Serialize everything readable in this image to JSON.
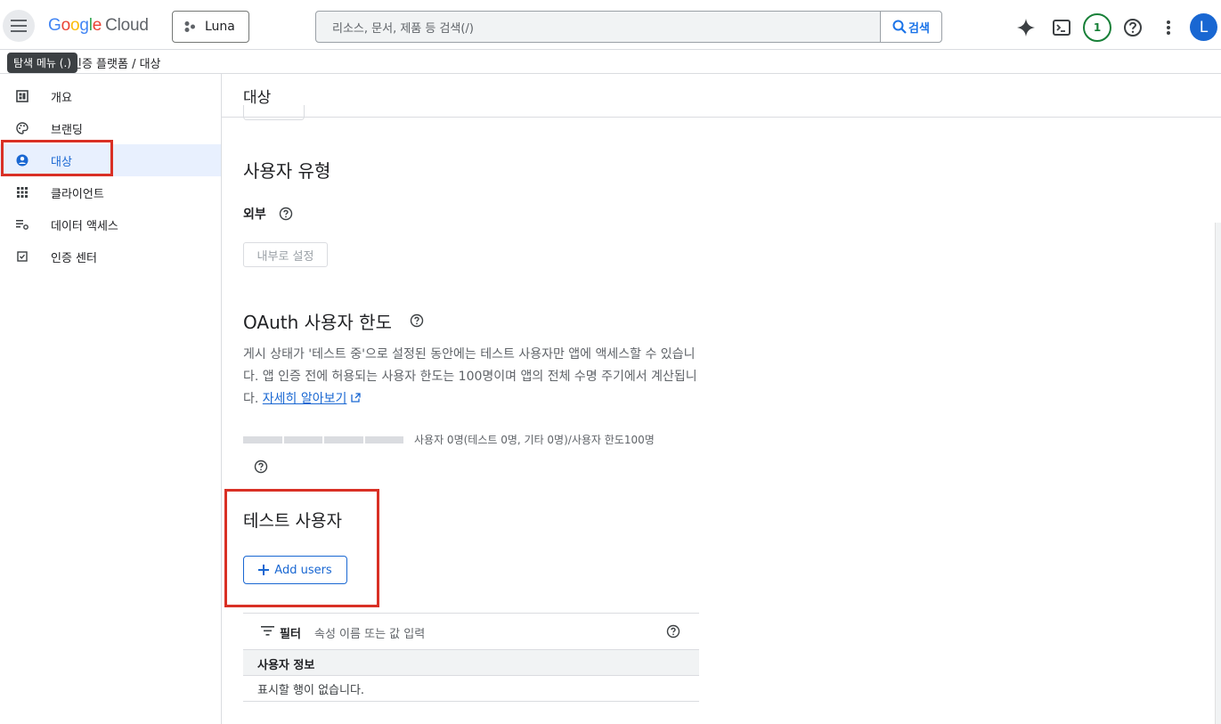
{
  "header": {
    "menu_tooltip": "탐색 메뉴 (.)",
    "logo_google": [
      "G",
      "o",
      "o",
      "g",
      "l",
      "e"
    ],
    "logo_cloud": "Cloud",
    "project_name": "Luna",
    "search_placeholder": "리소스, 문서, 제품 등 검색(/)",
    "search_button": "검색",
    "notifications_count": "1",
    "avatar_letter": "L"
  },
  "breadcrumb": {
    "text": "Google 인증 플랫폼 / 대상",
    "visible": "인증 플랫폼  /  대상"
  },
  "sidebar": {
    "items": [
      {
        "label": "개요",
        "icon": "dashboard-icon"
      },
      {
        "label": "브랜딩",
        "icon": "palette-icon"
      },
      {
        "label": "대상",
        "icon": "account-circle-icon",
        "active": true
      },
      {
        "label": "클라이언트",
        "icon": "apps-grid-icon"
      },
      {
        "label": "데이터 액세스",
        "icon": "data-settings-icon"
      },
      {
        "label": "인증 센터",
        "icon": "verified-check-icon"
      }
    ]
  },
  "main": {
    "page_title": "대상",
    "user_type": {
      "heading": "사용자 유형",
      "value": "외부",
      "button": "내부로 설정"
    },
    "oauth_limit": {
      "heading": "OAuth 사용자 한도",
      "paragraph": "게시 상태가 '테스트 중'으로 설정된 동안에는 테스트 사용자만 앱에 액세스할 수 있습니다. 앱 인증 전에 허용되는 사용자 한도는 100명이며 앱의 전체 수명 주기에서 계산됩니다.",
      "learn_more": "자세히 알아보기",
      "usage_text": "사용자 0명(테스트 0명, 기타 0명)/사용자 한도100명",
      "usage_fraction": 0
    },
    "test_users": {
      "heading": "테스트 사용자",
      "add_button": "Add users",
      "filter_label": "필터",
      "filter_placeholder": "속성 이름 또는 값 입력",
      "column_header": "사용자 정보",
      "empty_text": "표시할 행이 없습니다."
    }
  },
  "colors": {
    "accent": "#1967d2",
    "highlight_box": "#d93025",
    "active_bg": "#e8f0fe"
  }
}
